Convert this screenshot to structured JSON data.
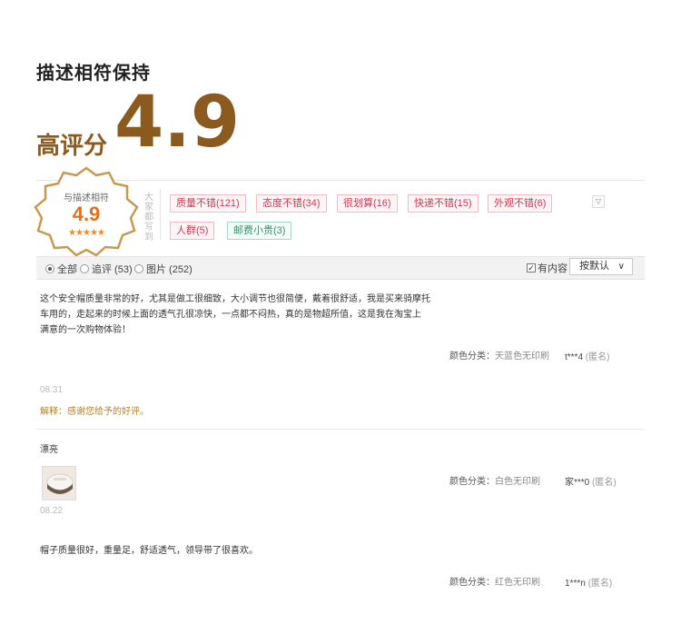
{
  "header": {
    "subtitle": "描述相符保持",
    "score_label": "高评分",
    "score": "4.9"
  },
  "badge": {
    "title": "与描述相符",
    "score": "4.9",
    "stars": "★★★★★"
  },
  "tags_caption": "大家都写到",
  "tags": [
    {
      "label": "质量不错(121)",
      "color": "pink"
    },
    {
      "label": "态度不错(34)",
      "color": "pink"
    },
    {
      "label": "很划算(16)",
      "color": "pink"
    },
    {
      "label": "快递不错(15)",
      "color": "pink"
    },
    {
      "label": "外观不错(6)",
      "color": "pink"
    },
    {
      "label": "人群(5)",
      "color": "pink"
    },
    {
      "label": "邮费小贵(3)",
      "color": "green"
    }
  ],
  "filters": {
    "all": "全部",
    "append": "追评 (53)",
    "pics": "图片 (252)",
    "has_content": "有内容",
    "sort": "按默认"
  },
  "reviews": [
    {
      "text": "这个安全帽质量非常的好，尤其是做工很细致，大小调节也很简便，戴着很舒适，我是买来骑摩托车用的，走起来的时候上面的透气孔很凉快，一点都不闷热，真的是物超所值，这是我在淘宝上　满意的一次购物体验！",
      "sku_label": "颜色分类：",
      "sku_value": "天蓝色无印刷",
      "user": "t***4",
      "anon": "(匿名)",
      "date": "08.31",
      "reply": "解释：感谢您给予的好评。"
    },
    {
      "text": "漂亮",
      "sku_label": "颜色分类：",
      "sku_value": "白色无印刷",
      "user": "家***0",
      "anon": "(匿名)",
      "date": "08.22"
    },
    {
      "text": "帽子质量很好，重量足，舒适透气，领导带了很喜欢。",
      "sku_label": "颜色分类：",
      "sku_value": "红色无印刷",
      "user": "1***n",
      "anon": "(匿名)"
    }
  ],
  "colors": {
    "brand_brown": "#8b5a1f",
    "badge_orange": "#e0701b",
    "tag_pink": "#d4364f",
    "tag_green": "#3f8f6f"
  }
}
